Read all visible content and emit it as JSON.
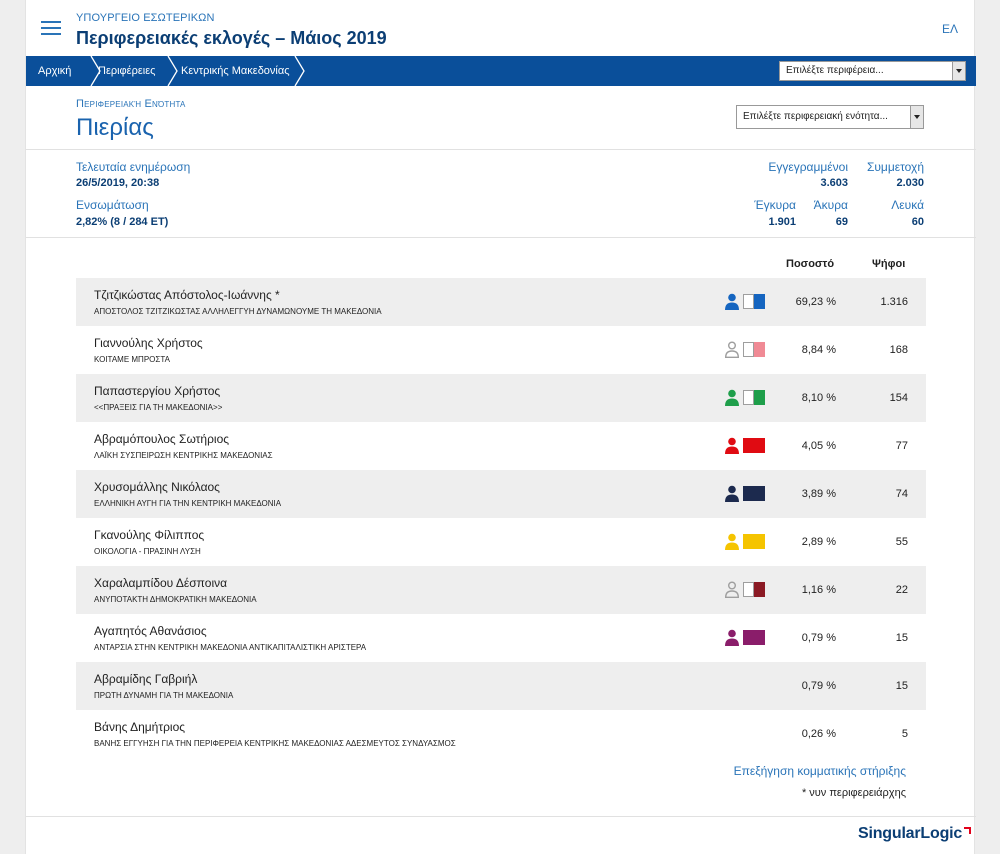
{
  "header": {
    "ministry": "ΥΠΟΥΡΓΕΙΟ ΕΣΩΤΕΡΙΚΩΝ",
    "title": "Περιφερειακές εκλογές – Μάιος 2019",
    "language": "ΕΛ"
  },
  "breadcrumb": [
    "Αρχική",
    "Περιφέρειες",
    "Κεντρικής Μακεδονίας"
  ],
  "region_select": {
    "value": "Επιλέξτε περιφέρεια..."
  },
  "unit": {
    "label": "Περιφερειακή Ενότητα",
    "name": "Πιερίας",
    "select_value": "Επιλέξτε περιφερειακή ενότητα..."
  },
  "stats": {
    "last_update_label": "Τελευταία ενημέρωση",
    "last_update_value": "26/5/2019, 20:38",
    "integration_label": "Ενσωμάτωση",
    "integration_value": "2,82% (8 / 284 ΕΤ)",
    "registered_label": "Εγγεγραμμένοι",
    "registered_value": "3.603",
    "turnout_label": "Συμμετοχή",
    "turnout_value": "2.030",
    "valid_label": "Έγκυρα",
    "valid_value": "1.901",
    "invalid_label": "Άκυρα",
    "invalid_value": "69",
    "blank_label": "Λευκά",
    "blank_value": "60"
  },
  "table": {
    "headers": {
      "percent": "Ποσοστό",
      "votes": "Ψήφοι"
    },
    "rows": [
      {
        "name": "Τζιτζικώστας Απόστολος-Ιωάννης *",
        "party": "ΑΠΟΣΤΟΛΟΣ ΤΖΙΤΖΙΚΩΣΤΑΣ ΑΛΛΗΛΕΓΓΥΗ ΔΥΝΑΜΩΝΟΥΜΕ ΤΗ ΜΑΚΕΔΟΝΙΑ",
        "percent": "69,23 %",
        "votes": "1.316",
        "person_color": "#1565c0",
        "person_outline": false,
        "flag_color": "#1565c0"
      },
      {
        "name": "Γιαννούλης Χρήστος",
        "party": "ΚΟΙΤΑΜΕ ΜΠΡΟΣΤΑ",
        "percent": "8,84 %",
        "votes": "168",
        "person_color": "#9e9e9e",
        "person_outline": true,
        "flag_color": "#f08a95"
      },
      {
        "name": "Παπαστεργίου Χρήστος",
        "party": "<<ΠΡΑΞΕΙΣ ΓΙΑ ΤΗ ΜΑΚΕΔΟΝΙΑ>>",
        "percent": "8,10 %",
        "votes": "154",
        "person_color": "#1e9e4a",
        "person_outline": false,
        "flag_color": "#1e9e4a"
      },
      {
        "name": "Αβραμόπουλος Σωτήριος",
        "party": "ΛΑΪΚΗ ΣΥΣΠΕΙΡΩΣΗ ΚΕΝΤΡΙΚΗΣ ΜΑΚΕΔΟΝΙΑΣ",
        "percent": "4,05 %",
        "votes": "77",
        "person_color": "#e00b12",
        "person_outline": false,
        "flag_color": "#e00b12"
      },
      {
        "name": "Χρυσομάλλης Νικόλαος",
        "party": "ΕΛΛΗΝΙΚΗ ΑΥΓΗ ΓΙΑ ΤΗΝ ΚΕΝΤΡΙΚΗ ΜΑΚΕΔΟΝΙΑ",
        "percent": "3,89 %",
        "votes": "74",
        "person_color": "#1c2a4e",
        "person_outline": false,
        "flag_color": "#1c2a4e"
      },
      {
        "name": "Γκανούλης Φίλιππος",
        "party": "ΟΙΚΟΛΟΓΙΑ - ΠΡΑΣΙΝΗ ΛΥΣΗ",
        "percent": "2,89 %",
        "votes": "55",
        "person_color": "#f5c400",
        "person_outline": false,
        "flag_color": "#f5c400"
      },
      {
        "name": "Χαραλαμπίδου Δέσποινα",
        "party": "ΑΝΥΠΟΤΑΚΤΗ ΔΗΜΟΚΡΑΤΙΚΗ ΜΑΚΕΔΟΝΙΑ",
        "percent": "1,16 %",
        "votes": "22",
        "person_color": "#9e9e9e",
        "person_outline": true,
        "flag_color": "#8b1a24"
      },
      {
        "name": "Αγαπητός Αθανάσιος",
        "party": "ΑΝΤΑΡΣΙΑ ΣΤΗΝ ΚΕΝΤΡΙΚΗ ΜΑΚΕΔΟΝΙΑ ΑΝΤΙΚΑΠΙΤΑΛΙΣΤΙΚΗ ΑΡΙΣΤΕΡΑ",
        "percent": "0,79 %",
        "votes": "15",
        "person_color": "#8a1d6a",
        "person_outline": false,
        "flag_color": "#8a1d6a"
      },
      {
        "name": "Αβραμίδης Γαβριήλ",
        "party": "ΠΡΩΤΗ ΔΥΝΑΜΗ ΓΙΑ ΤΗ ΜΑΚΕΔΟΝΙΑ",
        "percent": "0,79 %",
        "votes": "15",
        "person_color": null,
        "person_outline": false,
        "flag_color": null
      },
      {
        "name": "Βάνης Δημήτριος",
        "party": "ΒΑΝΗΣ ΕΓΓΥΗΣΗ ΓΙΑ ΤΗΝ ΠΕΡΙΦΕΡΕΙΑ ΚΕΝΤΡΙΚΗΣ ΜΑΚΕΔΟΝΙΑΣ ΑΔΕΣΜΕΥΤΟΣ ΣΥΝΔΥΑΣΜΟΣ",
        "percent": "0,26 %",
        "votes": "5",
        "person_color": null,
        "person_outline": false,
        "flag_color": null
      }
    ]
  },
  "support_link": "Επεξήγηση κομματικής στήριξης",
  "footnote": "* νυν περιφερειάρχης",
  "logo": {
    "text_main": "Singular",
    "text_accent": "Logic"
  },
  "colors": {
    "nav_bar": "#0a4f9a",
    "accent_blue": "#2a74b8",
    "dark_blue": "#0b3e74",
    "logo_red": "#e2001a"
  }
}
